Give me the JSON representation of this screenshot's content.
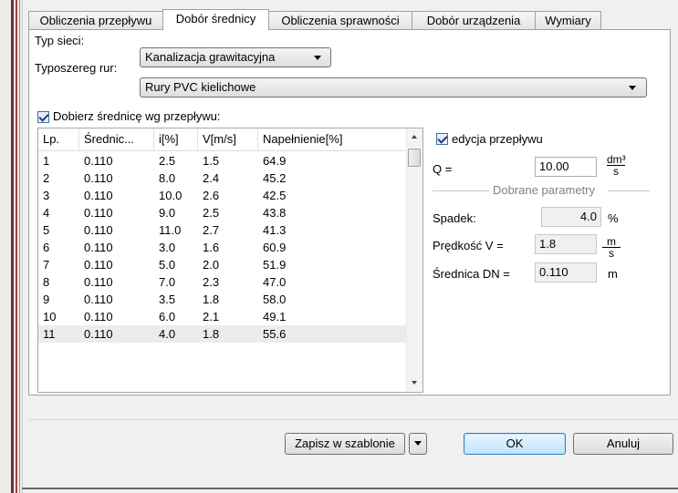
{
  "tabs": [
    {
      "label": "Obliczenia przepływu",
      "active": false
    },
    {
      "label": "Dobór średnicy",
      "active": true
    },
    {
      "label": "Obliczenia sprawności",
      "active": false
    },
    {
      "label": "Dobór urządzenia",
      "active": false
    },
    {
      "label": "Wymiary",
      "active": false
    }
  ],
  "form": {
    "network_type_label": "Typ sieci:",
    "network_type_value": "Kanalizacja grawitacyjna",
    "pipe_series_label": "Typoszereg rur:",
    "pipe_series_value": "Rury PVC kielichowe",
    "auto_diameter_label": "Dobierz średnicę wg przepływu:",
    "auto_diameter_checked": true
  },
  "table": {
    "columns": [
      "Lp.",
      "Średnic...",
      "i[%]",
      "V[m/s]",
      "Napełnienie[%]"
    ],
    "rows": [
      [
        "1",
        "0.110",
        "2.5",
        "1.5",
        "64.9"
      ],
      [
        "2",
        "0.110",
        "8.0",
        "2.4",
        "45.2"
      ],
      [
        "3",
        "0.110",
        "10.0",
        "2.6",
        "42.5"
      ],
      [
        "4",
        "0.110",
        "9.0",
        "2.5",
        "43.8"
      ],
      [
        "5",
        "0.110",
        "11.0",
        "2.7",
        "41.3"
      ],
      [
        "6",
        "0.110",
        "3.0",
        "1.6",
        "60.9"
      ],
      [
        "7",
        "0.110",
        "5.0",
        "2.0",
        "51.9"
      ],
      [
        "8",
        "0.110",
        "7.0",
        "2.3",
        "47.0"
      ],
      [
        "9",
        "0.110",
        "3.5",
        "1.8",
        "58.0"
      ],
      [
        "10",
        "0.110",
        "6.0",
        "2.1",
        "49.1"
      ],
      [
        "11",
        "0.110",
        "4.0",
        "1.8",
        "55.6"
      ]
    ],
    "selected_row": 11
  },
  "flow": {
    "edit_label": "edycja przepływu",
    "edit_checked": true,
    "q_label": "Q =",
    "q_value": "10.00",
    "q_unit_num": "dm³",
    "q_unit_den": "s"
  },
  "params": {
    "group_title": "Dobrane parametry",
    "slope_label": "Spadek:",
    "slope_value": "4.0",
    "slope_unit": "%",
    "speed_label": "Prędkość V =",
    "speed_value": "1.8",
    "speed_unit_num": "m",
    "speed_unit_den": "s",
    "diameter_label": "Średnica DN =",
    "diameter_value": "0.110",
    "diameter_unit": "m"
  },
  "buttons": {
    "save_template": "Zapisz w szablonie",
    "ok": "OK",
    "cancel": "Anuluj"
  }
}
